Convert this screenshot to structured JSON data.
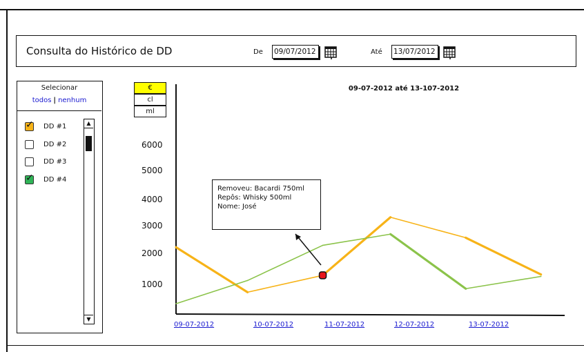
{
  "header": {
    "title": "Consulta do Histórico de DD",
    "from_label": "De",
    "from_value": "09/07/2012",
    "to_label": "Até",
    "to_value": "13/07/2012"
  },
  "selector": {
    "title": "Selecionar",
    "all_label": "todos",
    "separator": "|",
    "none_label": "nenhum",
    "items": [
      {
        "label": "DD #1",
        "checked": true,
        "color": "#f7b318"
      },
      {
        "label": "DD #2",
        "checked": false
      },
      {
        "label": "DD #3",
        "checked": false
      },
      {
        "label": "DD #4",
        "checked": true,
        "color": "#2fb457"
      }
    ]
  },
  "units": [
    "€",
    "cl",
    "ml"
  ],
  "selected_unit": "€",
  "tooltip": {
    "line1": "Removeu: Bacardi 750ml",
    "line2": "Repôs: Whisky 500ml",
    "line3": "Nome: José"
  },
  "chart_data": {
    "type": "line",
    "title": "09-07-2012 até 13-107-2012",
    "x": [
      "09-07-2012",
      "10-07-2012",
      "11-07-2012",
      "12-07-2012",
      "13-07-2012"
    ],
    "x_positions": [
      0,
      1,
      2,
      3,
      4,
      5
    ],
    "yticks": [
      1000,
      2000,
      3000,
      4000,
      5000,
      6000
    ],
    "ylim": [
      0,
      7000
    ],
    "series": [
      {
        "color": "#f7b318",
        "points": [
          [
            0,
            2450
          ],
          [
            0.95,
            800
          ],
          [
            1.95,
            1420
          ],
          [
            2.85,
            3550
          ],
          [
            3.85,
            2800
          ],
          [
            4.85,
            1450
          ]
        ]
      },
      {
        "color": "#8bc34a",
        "points": [
          [
            0,
            380
          ],
          [
            0.95,
            1230
          ],
          [
            1.95,
            2520
          ],
          [
            2.85,
            2930
          ],
          [
            3.85,
            930
          ],
          [
            4.85,
            1380
          ]
        ]
      }
    ],
    "highlight_point": [
      1.95,
      1420
    ],
    "highlight_color": "#e8141a"
  }
}
